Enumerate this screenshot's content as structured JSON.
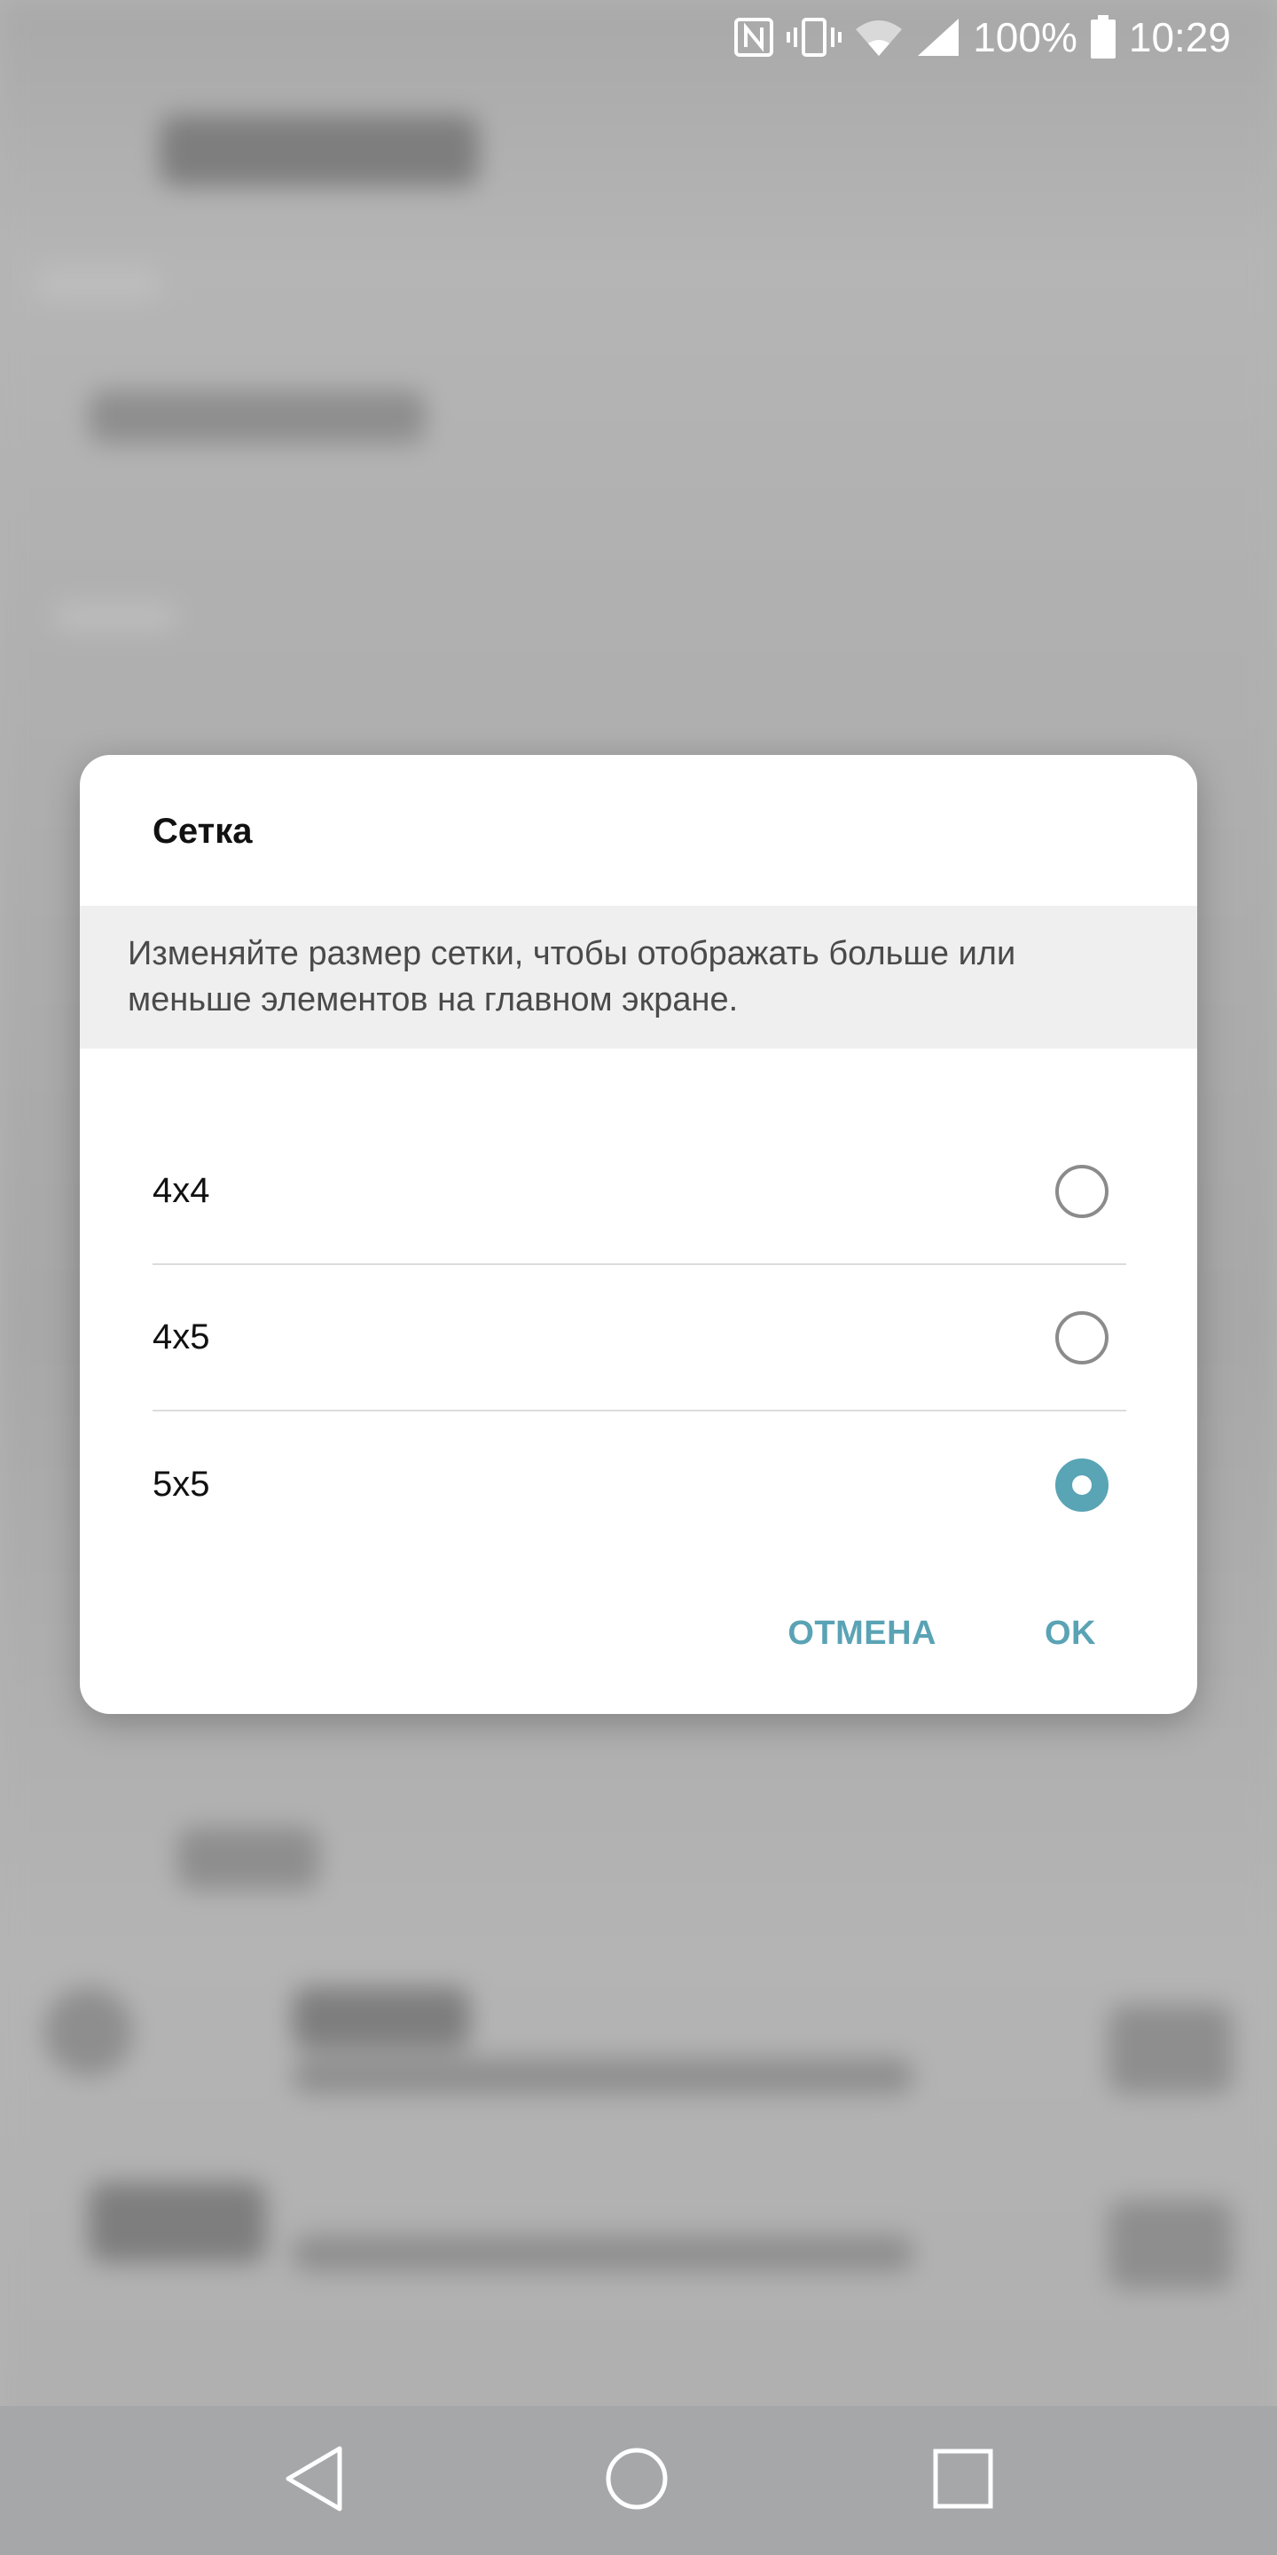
{
  "status_bar": {
    "battery_percent": "100%",
    "time": "10:29",
    "icons": [
      "nfc-icon",
      "vibrate-icon",
      "wifi-icon",
      "signal-icon",
      "battery-icon"
    ]
  },
  "dialog": {
    "title": "Сетка",
    "description": "Изменяйте размер сетки, чтобы отображать больше или меньше элементов на главном экране.",
    "options": [
      {
        "label": "4x4",
        "selected": false
      },
      {
        "label": "4x5",
        "selected": false
      },
      {
        "label": "5x5",
        "selected": true
      }
    ],
    "cancel_label": "ОТМЕНА",
    "ok_label": "OK"
  },
  "navigation": {
    "icons": [
      "back-icon",
      "home-icon",
      "recents-icon"
    ]
  },
  "colors": {
    "accent": "#59a4b5",
    "scrim": "#b3b3b3"
  }
}
